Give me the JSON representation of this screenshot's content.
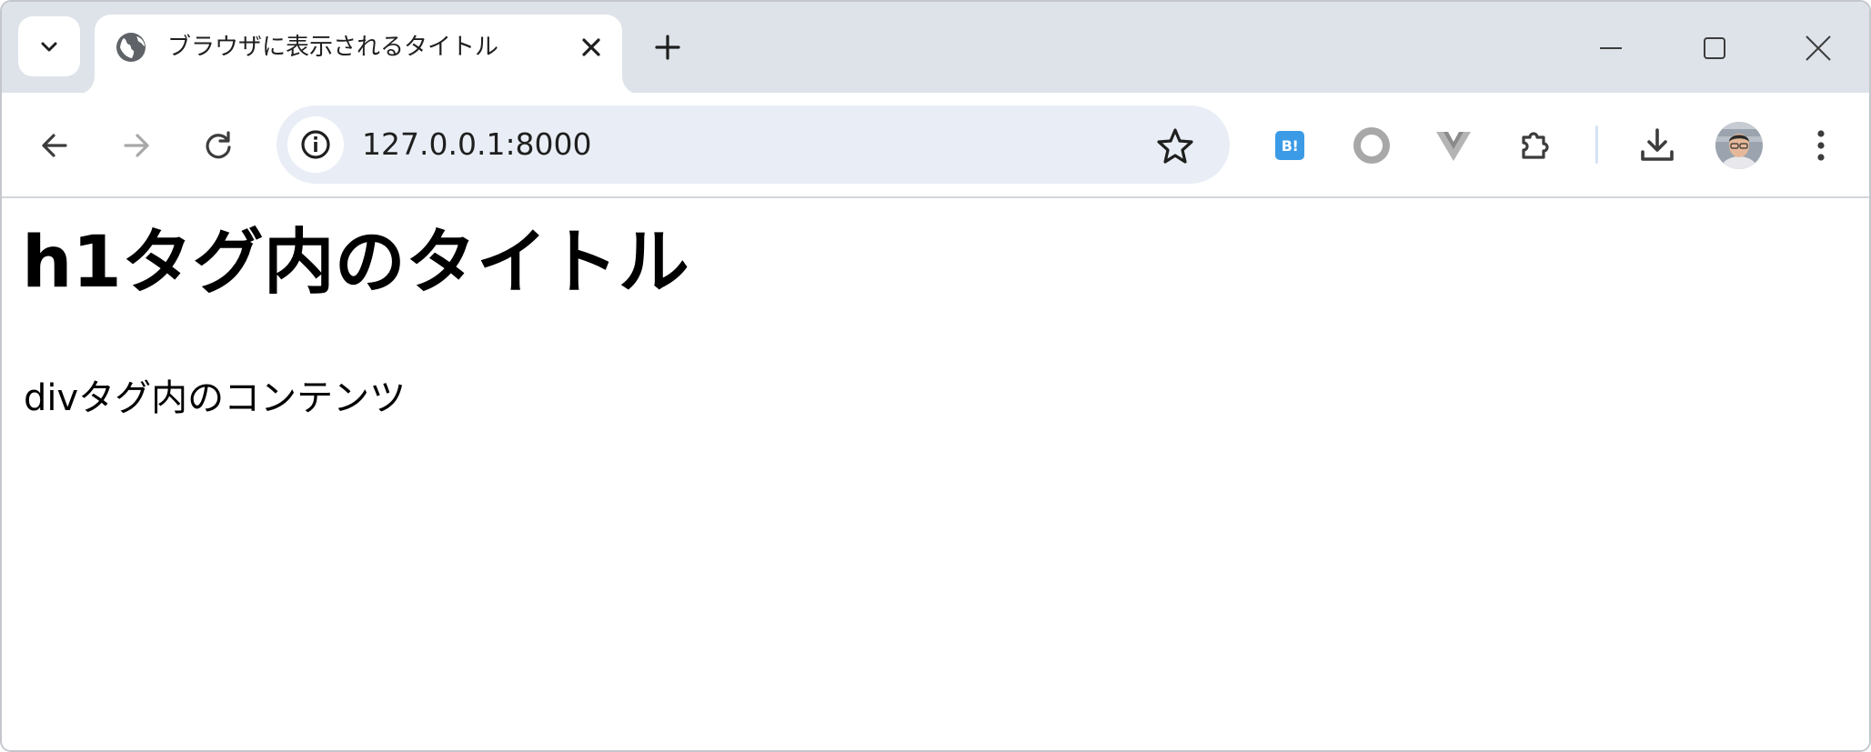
{
  "tab": {
    "title": "ブラウザに表示されるタイトル",
    "favicon": "globe-icon"
  },
  "tabstrip": {
    "tab_search_icon": "chevron-down-icon",
    "new_tab_icon": "plus-icon",
    "window_controls": [
      "minimize-icon",
      "maximize-icon",
      "close-icon"
    ]
  },
  "toolbar": {
    "back_icon": "arrow-left-icon",
    "forward_icon": "arrow-right-icon",
    "reload_icon": "reload-icon",
    "site_info_icon": "info-icon",
    "url": "127.0.0.1:8000",
    "bookmark_icon": "star-icon",
    "extensions": [
      {
        "name": "hatena-bookmark-extension",
        "label": "B!",
        "color": "#3c9be6"
      },
      {
        "name": "ring-extension",
        "icon": "ring-icon"
      },
      {
        "name": "vue-devtools-extension",
        "icon": "vue-icon"
      },
      {
        "name": "extensions-menu",
        "icon": "puzzle-icon"
      }
    ],
    "downloads_icon": "download-icon",
    "menu_icon": "kebab-menu-icon"
  },
  "page": {
    "h1": "h1タグ内のタイトル",
    "div": "divタグ内のコンテンツ"
  },
  "colors": {
    "tabstrip_bg": "#dee3ea",
    "omnibox_bg": "#e9eef6",
    "icon": "#3c3c3c",
    "icon_disabled": "#a8a8a8",
    "hatena_blue": "#3c9be6"
  }
}
